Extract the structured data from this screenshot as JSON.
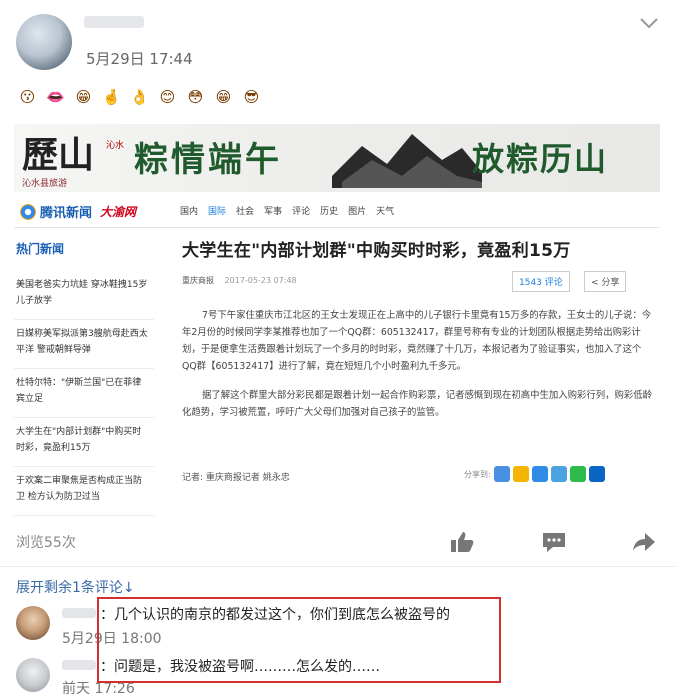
{
  "post": {
    "time": "5月29日 17:44",
    "emojis": [
      "😗",
      "👄",
      "😁",
      "🤞",
      "👌",
      "😊",
      "😳",
      "😁",
      "😎"
    ]
  },
  "article": {
    "banner": {
      "logo": "歷山",
      "logo_small": "沁水",
      "slogan_a": "粽情端午",
      "slogan_b": "放粽历山",
      "sub": "沁水县旅游"
    },
    "nav": {
      "logo": "腾讯新闻",
      "live": "大渝网",
      "items": [
        "国内",
        "国际",
        "社会",
        "军事",
        "评论",
        "历史",
        "图片",
        "天气"
      ],
      "active_index": 1
    },
    "sidebar": {
      "title": "热门新闻",
      "items": [
        "美国老爸实力坑娃 穿冰鞋拽15岁儿子放学",
        "日媒称美军拟派第3艘航母赴西太平洋 警戒朝鲜导弹",
        "杜特尔特：\"伊斯兰国\"已在菲律宾立足",
        "大学生在\"内部计划群\"中购买时时彩，竟盈利15万",
        "于欢案二审聚焦是否构成正当防卫 检方认为防卫过当"
      ]
    },
    "headline": "大学生在\"内部计划群\"中购买时时彩，竟盈利15万",
    "source": "重庆商报",
    "date": "2017-05-23 07:48",
    "comment_count": "1543 评论",
    "share_label": "分享",
    "paragraphs": [
      "7号下午家住重庆市江北区的王女士发现正在上高中的儿子银行卡里竟有15万多的存款，王女士的儿子说：今年2月份的时候同学李某推荐也加了一个QQ群：605132417，群里号称有专业的计划团队根据走势给出购彩计划，于是便拿生活费跟着计划玩了一个多月的时时彩，竟然赚了十几万，本报记者为了验证事实，也加入了这个QQ群【605132417】进行了解，竟在短短几个小时盈利九千多元。",
      "据了解这个群里大部分彩民都是跟着计划一起合作购彩票，记者感慨到现在初高中生加入购彩行列，购彩低龄化趋势，学习被荒置，呼吁广大父母们加强对自己孩子的监管。"
    ],
    "byline": "记者: 重庆商报记者 姚永忠",
    "share_to": "分享到:"
  },
  "footer": {
    "views": "浏览55次",
    "expand": "展开剩余1条评论↓"
  },
  "comments": [
    {
      "text": "：几个认识的南京的都发过这个，你们到底怎么被盗号的",
      "time": "5月29日 18:00"
    },
    {
      "text": "：问题是，我没被盗号啊………怎么发的……",
      "time": "前天 17:26"
    }
  ],
  "colors": {
    "link_blue": "#3a6aa6",
    "highlight_red": "#d32f2f",
    "banner_green": "#1f5b2c"
  }
}
